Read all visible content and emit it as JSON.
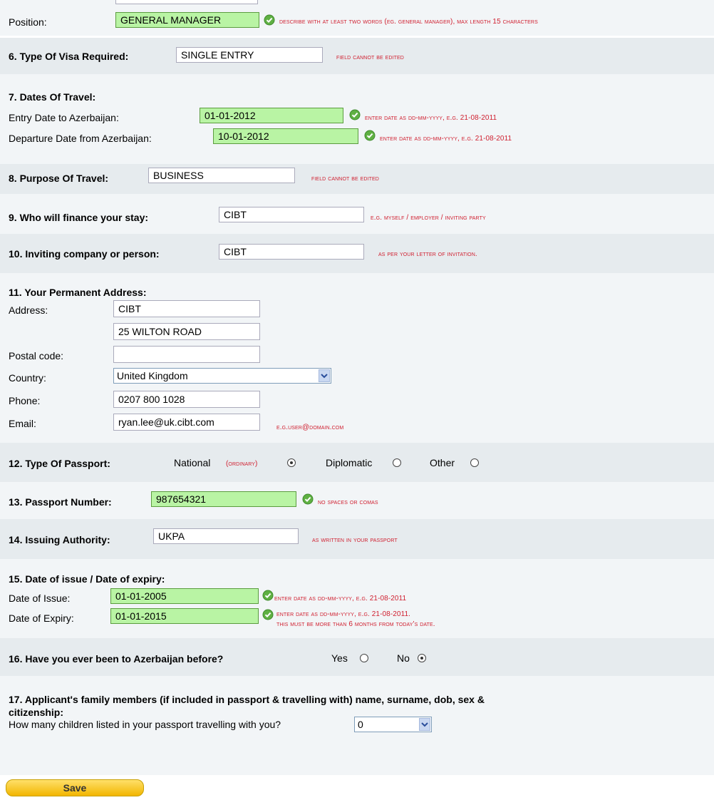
{
  "position": {
    "label": "Position:",
    "value": "GENERAL MANAGER",
    "hint": "Describe with at least two words (eg. General Manager), max length 15 characters"
  },
  "visa": {
    "label": "6. Type Of Visa Required:",
    "value": "SINGLE ENTRY",
    "hint": "Field cannot be edited"
  },
  "travel": {
    "heading": "7. Dates Of Travel:",
    "entry": {
      "label": "Entry Date to Azerbaijan:",
      "value": "01-01-2012",
      "hint": "Enter date as DD-MM-YYYY, e.g. 21-08-2011"
    },
    "departure": {
      "label": "Departure Date from Azerbaijan:",
      "value": "10-01-2012",
      "hint": "Enter date as DD-MM-YYYY, e.g. 21-08-2011"
    }
  },
  "purpose": {
    "label": "8. Purpose Of Travel:",
    "value": "BUSINESS",
    "hint": "Field cannot be edited"
  },
  "finance": {
    "label": "9. Who will finance your stay:",
    "value": "CIBT",
    "hint": "e.g. Myself / Employer / Inviting Party"
  },
  "inviting": {
    "label": "10. Inviting company or person:",
    "value": "CIBT",
    "hint": "As per your letter of invitation."
  },
  "address": {
    "heading": "11. Your Permanent Address:",
    "address_label": "Address:",
    "line1": "CIBT",
    "line2": "25 WILTON ROAD",
    "postal_label": "Postal code:",
    "postal": "",
    "country_label": "Country:",
    "country": "United Kingdom",
    "phone_label": "Phone:",
    "phone": "0207 800 1028",
    "email_label": "Email:",
    "email": "ryan.lee@uk.cibt.com",
    "email_hint": "e.g.user@domain.com"
  },
  "passport_type": {
    "label": "12. Type Of Passport:",
    "national": "National",
    "ordinary": "(ordinary)",
    "diplomatic": "Diplomatic",
    "other": "Other",
    "selected": "National"
  },
  "passport_number": {
    "label": "13. Passport Number:",
    "value": "987654321",
    "hint": "No spaces or comas"
  },
  "authority": {
    "label": "14. Issuing Authority:",
    "value": "UKPA",
    "hint": "As written in your passport"
  },
  "dates": {
    "heading": "15. Date of issue / Date of expiry:",
    "issue_label": "Date of Issue:",
    "issue": "01-01-2005",
    "issue_hint": "Enter date as DD-MM-YYYY, e.g. 21-08-2011",
    "expiry_label": "Date of Expiry:",
    "expiry": "01-01-2015",
    "expiry_hint1": "Enter date as DD-MM-YYYY, e.g. 21-08-2011.",
    "expiry_hint2": "This must be more than 6 months from today's date."
  },
  "been_before": {
    "label": "16. Have you ever been to Azerbaijan before?",
    "yes": "Yes",
    "no": "No",
    "selected": "No"
  },
  "family": {
    "heading1": "17. Applicant's family members (if included in passport & travelling with) name, surname, dob, sex &",
    "heading2": "citizenship:",
    "children_label": "How many children listed in your passport travelling with you?",
    "children": "0"
  },
  "save_label": "Save",
  "colors": {
    "hint": "#d02030",
    "valid_bg": "#b9f4a4",
    "section_bg": "#e6ebee",
    "save_bg": "#f2b500"
  }
}
